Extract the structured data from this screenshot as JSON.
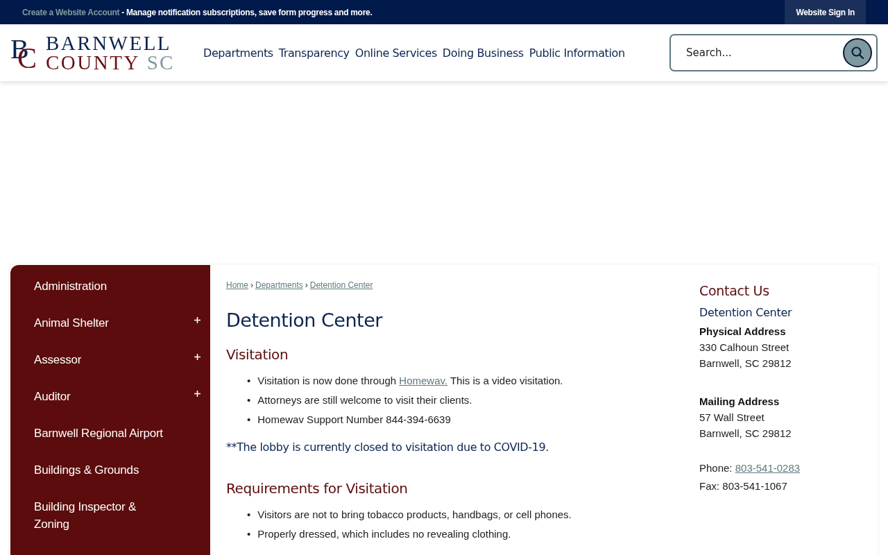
{
  "top_bar": {
    "link": "Create a Website Account",
    "message": "- Manage notification subscriptions, save form progress and more.",
    "sign_in": "Website Sign In"
  },
  "logo": {
    "monogram_b": "B",
    "monogram_c": "C",
    "line_1": "BARNWELL",
    "line_2": "COUNTY",
    "line_2_suffix": "SC"
  },
  "nav": [
    "Departments",
    "Transparency",
    "Online Services",
    "Doing Business",
    "Public Information"
  ],
  "search": {
    "placeholder": "Search..."
  },
  "sidebar": {
    "items": [
      {
        "label": "Administration",
        "expandable": false
      },
      {
        "label": "Animal Shelter",
        "expandable": true
      },
      {
        "label": "Assessor",
        "expandable": true
      },
      {
        "label": "Auditor",
        "expandable": true
      },
      {
        "label": "Barnwell Regional Airport",
        "expandable": false
      },
      {
        "label": "Buildings & Grounds",
        "expandable": false
      },
      {
        "label": "Building Inspector & Zoning",
        "expandable": false
      }
    ]
  },
  "breadcrumb": [
    "Home",
    "Departments",
    "Detention Center"
  ],
  "breadcrumb_separator": "›",
  "bullet_marker": "•",
  "page_title": "Detention Center",
  "sections": [
    {
      "heading": "Visitation",
      "bullets": [
        {
          "before": "Visitation is now done through ",
          "link": "Homewav.",
          "after": " This is a video visitation."
        },
        {
          "before": "Attorneys are still welcome to visit their clients."
        },
        {
          "before": "Homewav Support Number 844-394-6639"
        }
      ],
      "note": "**The lobby is currently closed to visitation due to COVID-19."
    },
    {
      "heading": "Requirements for Visitation",
      "bullets": [
        {
          "before": "Visitors are not to bring tobacco products, handbags, or cell phones."
        },
        {
          "before": "Properly dressed, which includes no revealing clothing."
        }
      ]
    }
  ],
  "contact": {
    "heading": "Contact Us",
    "department": "Detention Center",
    "addresses": [
      {
        "label": "Physical Address",
        "lines": [
          "330 Calhoun Street",
          "Barnwell, SC 29812"
        ]
      },
      {
        "label": "Mailing Address",
        "lines": [
          "57 Wall Street",
          "Barnwell, SC 29812"
        ]
      }
    ],
    "phone_label": "Phone:",
    "phone": "803-541-0283",
    "fax": "Fax: 803-541-1067"
  }
}
